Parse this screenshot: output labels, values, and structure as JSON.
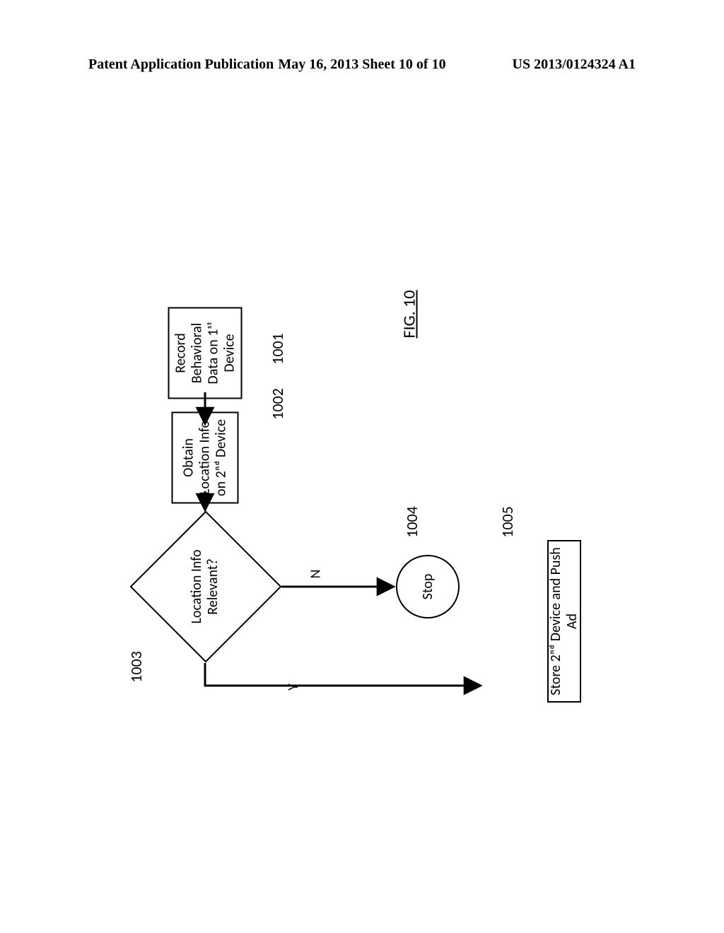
{
  "header": {
    "left": "Patent Application Publication",
    "center": "May 16, 2013  Sheet 10 of 10",
    "right": "US 2013/0124324 A1"
  },
  "figure": {
    "title": "FIG. 10",
    "step1": {
      "ref": "1001",
      "text": "Record Behavioral Data on 1ˢᵗ Device"
    },
    "step2": {
      "ref": "1002",
      "text": "Obtain Location Info on 2ⁿᵈ Device"
    },
    "decision": {
      "ref": "1003",
      "text": "Location Info Relevant?"
    },
    "no": {
      "label": "N"
    },
    "yes": {
      "label": "Y"
    },
    "stop": {
      "ref": "1004",
      "text": "Stop"
    },
    "step5": {
      "ref": "1005",
      "text": "Store 2ⁿᵈ Device and Push Ad"
    }
  }
}
